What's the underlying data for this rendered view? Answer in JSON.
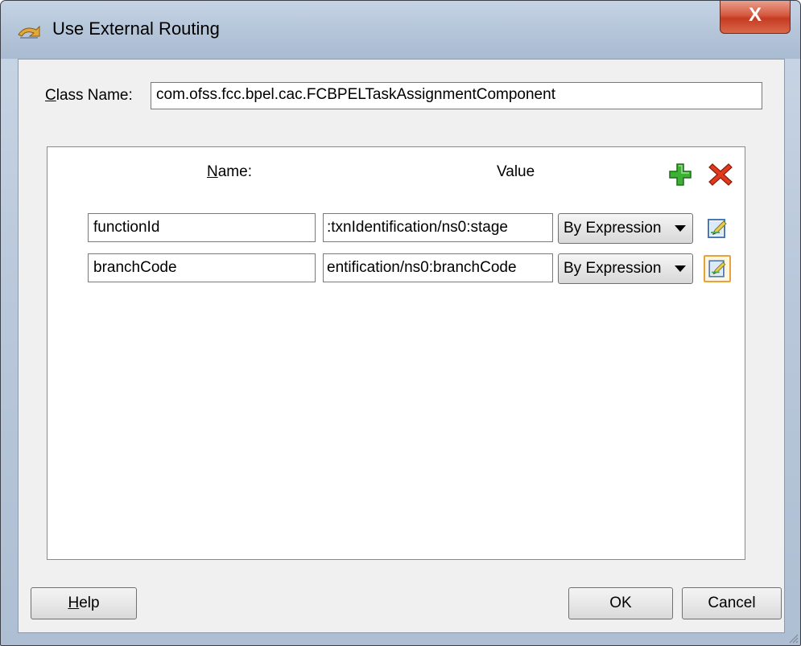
{
  "window": {
    "title": "Use External Routing",
    "close_glyph": "X",
    "icon": "routing-app-icon"
  },
  "class_name": {
    "label_prefix": "C",
    "label_rest": "lass Name:",
    "value": "com.ofss.fcc.bpel.cac.FCBPELTaskAssignmentComponent"
  },
  "table": {
    "header_name_prefix": "N",
    "header_name_rest": "ame:",
    "header_value": "Value",
    "add_icon": "plus-icon",
    "delete_icon": "red-x-icon",
    "rows": [
      {
        "name": "functionId",
        "value": ":txnIdentification/ns0:stage",
        "type": "By Expression"
      },
      {
        "name": "branchCode",
        "value": "entification/ns0:branchCode",
        "type": "By Expression"
      }
    ]
  },
  "buttons": {
    "help_prefix": "H",
    "help_rest": "elp",
    "ok": "OK",
    "cancel": "Cancel"
  },
  "colors": {
    "accent_focus": "#e7a33b",
    "add_green": "#2fa12a",
    "delete_red": "#d8361c"
  }
}
